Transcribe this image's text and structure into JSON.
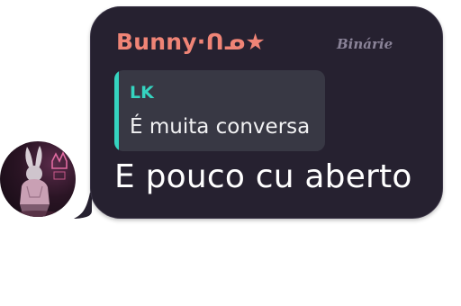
{
  "message": {
    "sender": {
      "name": "Bunny·ᑎᓄ★",
      "badge": "Binárie",
      "name_color": "#ef8476"
    },
    "reply": {
      "author": "LK",
      "text": "É muita conversa",
      "accent_color": "#35d4c0"
    },
    "text": "E pouco cu aberto",
    "bubble_color": "#262130",
    "avatar_icon": "bunny-avatar"
  }
}
